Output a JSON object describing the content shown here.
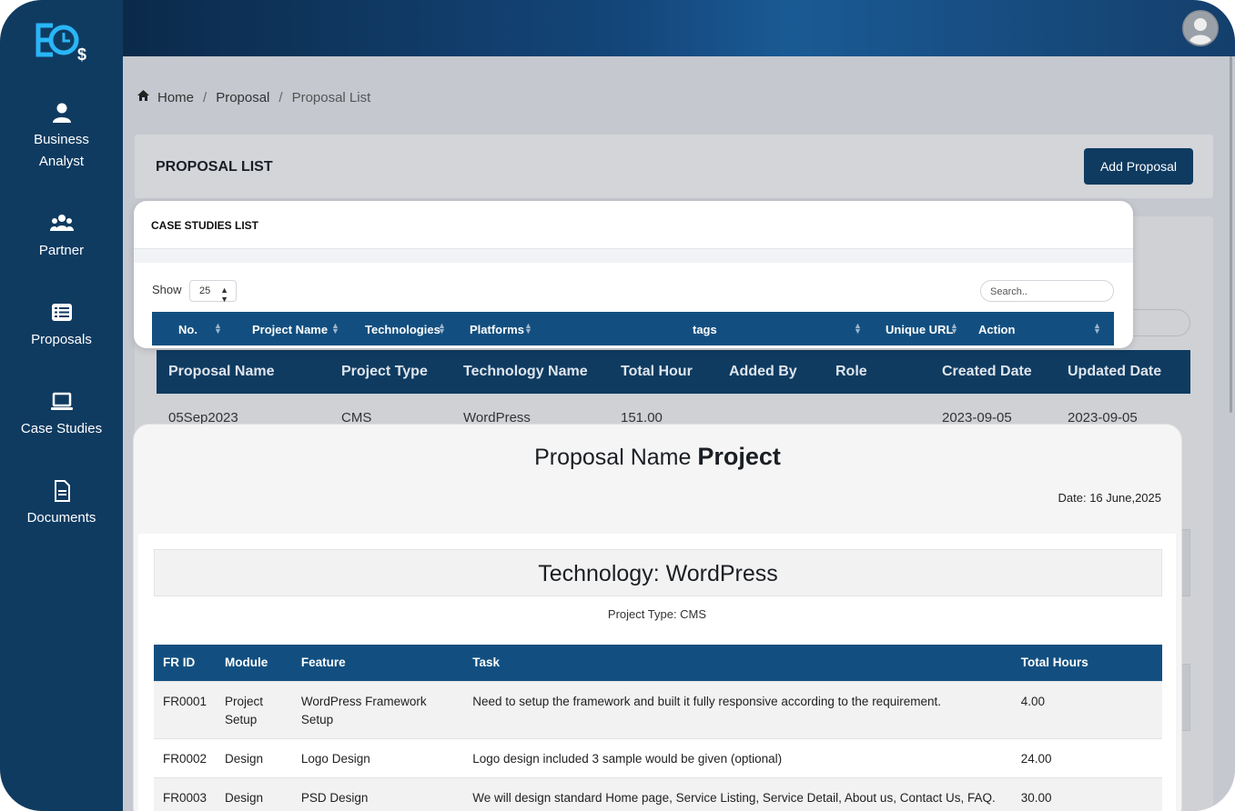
{
  "sidebar": {
    "items": [
      {
        "label_line1": "Business",
        "label_line2": "Analyst",
        "icon": "user-icon"
      },
      {
        "label": "Partner",
        "icon": "users-icon"
      },
      {
        "label": "Proposals",
        "icon": "list-icon"
      },
      {
        "label": "Case Studies",
        "icon": "laptop-icon"
      },
      {
        "label": "Documents",
        "icon": "document-icon"
      }
    ]
  },
  "breadcrumb": {
    "home": "Home",
    "proposal": "Proposal",
    "current": "Proposal List",
    "separator": "/"
  },
  "proposal_list": {
    "title": "PROPOSAL LIST",
    "add_button": "Add Proposal"
  },
  "bg_table": {
    "headers": [
      "Proposal Name",
      "Project Type",
      "Technology Name",
      "Total Hour",
      "Added By",
      "Role",
      "Created Date",
      "Updated Date"
    ],
    "row": [
      "05Sep2023",
      "CMS",
      "WordPress",
      "151.00",
      "2023-09-05",
      "2023-09-05"
    ]
  },
  "case_studies": {
    "title": "CASE STUDIES LIST",
    "show_label": "Show",
    "page_size": "25",
    "search_placeholder": "Search..",
    "headers": [
      "No.",
      "Project Name",
      "Technologies",
      "Platforms",
      "tags",
      "Unique URL",
      "Action"
    ]
  },
  "preview": {
    "heading_prefix": "Proposal Name",
    "heading_bold": "Project",
    "date": "Date: 16 June,2025",
    "technology": "Technology: WordPress",
    "project_type": "Project Type: CMS",
    "columns": [
      "FR ID",
      "Module",
      "Feature",
      "Task",
      "Total Hours"
    ],
    "rows": [
      {
        "id": "FR0001",
        "module": "Project Setup",
        "feature": "WordPress Framework Setup",
        "task": "Need to setup the framework and built it fully responsive according to the requirement.",
        "hours": "4.00"
      },
      {
        "id": "FR0002",
        "module": "Design",
        "feature": "Logo Design",
        "task": "Logo design included 3 sample would be given (optional)",
        "hours": "24.00"
      },
      {
        "id": "FR0003",
        "module": "Design",
        "feature": "PSD Design",
        "task": "We will design standard Home page, Service Listing, Service Detail, About us, Contact Us, FAQ.",
        "hours": "30.00"
      }
    ]
  },
  "colors": {
    "sidebar": "#0f3b61",
    "table_header": "#124f80",
    "accent_logo": "#29b6f6"
  }
}
